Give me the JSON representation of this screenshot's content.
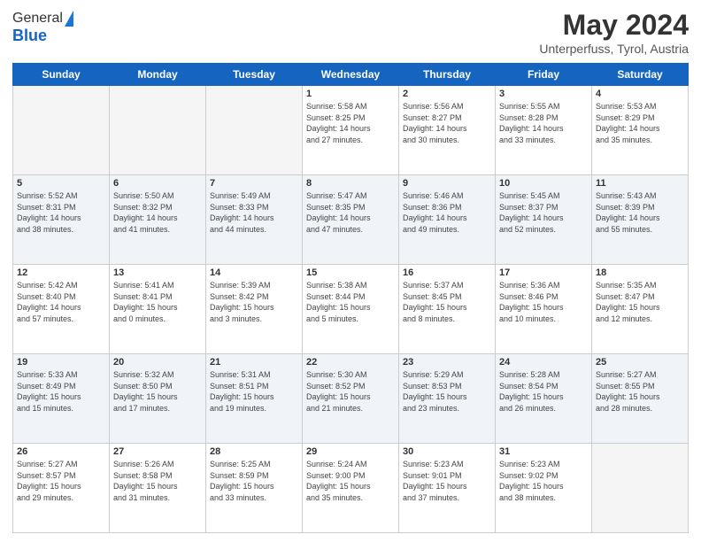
{
  "header": {
    "logo_general": "General",
    "logo_blue": "Blue",
    "main_title": "May 2024",
    "subtitle": "Unterperfuss, Tyrol, Austria"
  },
  "calendar": {
    "days_of_week": [
      "Sunday",
      "Monday",
      "Tuesday",
      "Wednesday",
      "Thursday",
      "Friday",
      "Saturday"
    ],
    "weeks": [
      [
        {
          "day": "",
          "info": ""
        },
        {
          "day": "",
          "info": ""
        },
        {
          "day": "",
          "info": ""
        },
        {
          "day": "1",
          "info": "Sunrise: 5:58 AM\nSunset: 8:25 PM\nDaylight: 14 hours\nand 27 minutes."
        },
        {
          "day": "2",
          "info": "Sunrise: 5:56 AM\nSunset: 8:27 PM\nDaylight: 14 hours\nand 30 minutes."
        },
        {
          "day": "3",
          "info": "Sunrise: 5:55 AM\nSunset: 8:28 PM\nDaylight: 14 hours\nand 33 minutes."
        },
        {
          "day": "4",
          "info": "Sunrise: 5:53 AM\nSunset: 8:29 PM\nDaylight: 14 hours\nand 35 minutes."
        }
      ],
      [
        {
          "day": "5",
          "info": "Sunrise: 5:52 AM\nSunset: 8:31 PM\nDaylight: 14 hours\nand 38 minutes."
        },
        {
          "day": "6",
          "info": "Sunrise: 5:50 AM\nSunset: 8:32 PM\nDaylight: 14 hours\nand 41 minutes."
        },
        {
          "day": "7",
          "info": "Sunrise: 5:49 AM\nSunset: 8:33 PM\nDaylight: 14 hours\nand 44 minutes."
        },
        {
          "day": "8",
          "info": "Sunrise: 5:47 AM\nSunset: 8:35 PM\nDaylight: 14 hours\nand 47 minutes."
        },
        {
          "day": "9",
          "info": "Sunrise: 5:46 AM\nSunset: 8:36 PM\nDaylight: 14 hours\nand 49 minutes."
        },
        {
          "day": "10",
          "info": "Sunrise: 5:45 AM\nSunset: 8:37 PM\nDaylight: 14 hours\nand 52 minutes."
        },
        {
          "day": "11",
          "info": "Sunrise: 5:43 AM\nSunset: 8:39 PM\nDaylight: 14 hours\nand 55 minutes."
        }
      ],
      [
        {
          "day": "12",
          "info": "Sunrise: 5:42 AM\nSunset: 8:40 PM\nDaylight: 14 hours\nand 57 minutes."
        },
        {
          "day": "13",
          "info": "Sunrise: 5:41 AM\nSunset: 8:41 PM\nDaylight: 15 hours\nand 0 minutes."
        },
        {
          "day": "14",
          "info": "Sunrise: 5:39 AM\nSunset: 8:42 PM\nDaylight: 15 hours\nand 3 minutes."
        },
        {
          "day": "15",
          "info": "Sunrise: 5:38 AM\nSunset: 8:44 PM\nDaylight: 15 hours\nand 5 minutes."
        },
        {
          "day": "16",
          "info": "Sunrise: 5:37 AM\nSunset: 8:45 PM\nDaylight: 15 hours\nand 8 minutes."
        },
        {
          "day": "17",
          "info": "Sunrise: 5:36 AM\nSunset: 8:46 PM\nDaylight: 15 hours\nand 10 minutes."
        },
        {
          "day": "18",
          "info": "Sunrise: 5:35 AM\nSunset: 8:47 PM\nDaylight: 15 hours\nand 12 minutes."
        }
      ],
      [
        {
          "day": "19",
          "info": "Sunrise: 5:33 AM\nSunset: 8:49 PM\nDaylight: 15 hours\nand 15 minutes."
        },
        {
          "day": "20",
          "info": "Sunrise: 5:32 AM\nSunset: 8:50 PM\nDaylight: 15 hours\nand 17 minutes."
        },
        {
          "day": "21",
          "info": "Sunrise: 5:31 AM\nSunset: 8:51 PM\nDaylight: 15 hours\nand 19 minutes."
        },
        {
          "day": "22",
          "info": "Sunrise: 5:30 AM\nSunset: 8:52 PM\nDaylight: 15 hours\nand 21 minutes."
        },
        {
          "day": "23",
          "info": "Sunrise: 5:29 AM\nSunset: 8:53 PM\nDaylight: 15 hours\nand 23 minutes."
        },
        {
          "day": "24",
          "info": "Sunrise: 5:28 AM\nSunset: 8:54 PM\nDaylight: 15 hours\nand 26 minutes."
        },
        {
          "day": "25",
          "info": "Sunrise: 5:27 AM\nSunset: 8:55 PM\nDaylight: 15 hours\nand 28 minutes."
        }
      ],
      [
        {
          "day": "26",
          "info": "Sunrise: 5:27 AM\nSunset: 8:57 PM\nDaylight: 15 hours\nand 29 minutes."
        },
        {
          "day": "27",
          "info": "Sunrise: 5:26 AM\nSunset: 8:58 PM\nDaylight: 15 hours\nand 31 minutes."
        },
        {
          "day": "28",
          "info": "Sunrise: 5:25 AM\nSunset: 8:59 PM\nDaylight: 15 hours\nand 33 minutes."
        },
        {
          "day": "29",
          "info": "Sunrise: 5:24 AM\nSunset: 9:00 PM\nDaylight: 15 hours\nand 35 minutes."
        },
        {
          "day": "30",
          "info": "Sunrise: 5:23 AM\nSunset: 9:01 PM\nDaylight: 15 hours\nand 37 minutes."
        },
        {
          "day": "31",
          "info": "Sunrise: 5:23 AM\nSunset: 9:02 PM\nDaylight: 15 hours\nand 38 minutes."
        },
        {
          "day": "",
          "info": ""
        }
      ]
    ]
  }
}
